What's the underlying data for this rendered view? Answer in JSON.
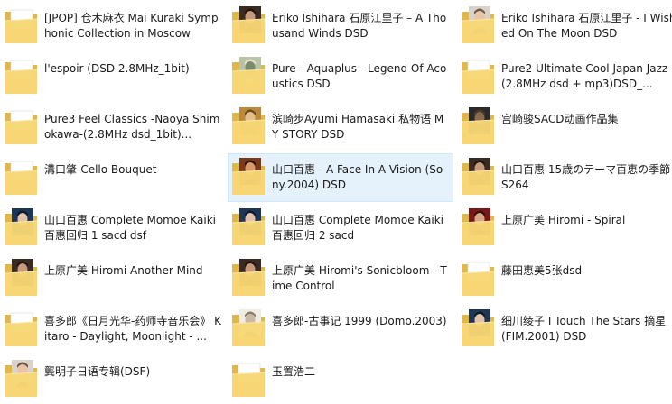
{
  "items": [
    {
      "name": "[JPOP] 仓木麻衣 Mai Kuraki Symphonic Collection in Moscow",
      "thumb": "none"
    },
    {
      "name": "Eriko Ishihara 石原江里子 – A Thousand Winds  DSD",
      "thumb": "portrait"
    },
    {
      "name": "Eriko Ishihara 石原江里子 - I Wished On The Moon DSD",
      "thumb": "portrait-light"
    },
    {
      "name": "l'espoir (DSD 2.8MHz_1bit)",
      "thumb": "none"
    },
    {
      "name": "Pure - Aquaplus - Legend Of Acoustics DSD",
      "thumb": "art"
    },
    {
      "name": "Pure2 Ultimate Cool Japan Jazz(2.8MHz dsd + mp3)DSD_...",
      "thumb": "none"
    },
    {
      "name": "Pure3 Feel Classics -Naoya Shimokawa-(2.8MHz dsd_1bit)...",
      "thumb": "none"
    },
    {
      "name": "滨崎步Ayumi Hamasaki 私物语 MY STORY DSD",
      "thumb": "portrait-gold"
    },
    {
      "name": "宫崎骏SACD动画作品集",
      "thumb": "art-dark"
    },
    {
      "name": "溝口肇-Cello Bouquet",
      "thumb": "none"
    },
    {
      "name": "山口百惠 - A Face In A Vision (Sony.2004) DSD",
      "thumb": "portrait-warm"
    },
    {
      "name": "山口百惠 15歳のテーマ百恵の季節 -S264",
      "thumb": "portrait"
    },
    {
      "name": "山口百惠 Complete Momoe Kaiki 百惠回归  1 sacd  dsf",
      "thumb": "portrait-blue"
    },
    {
      "name": "山口百惠 Complete Momoe Kaiki 百惠回归  2 sacd",
      "thumb": "portrait-blue"
    },
    {
      "name": "上原广美 Hiromi - Spiral",
      "thumb": "portrait-red"
    },
    {
      "name": "上原广美 Hiromi Another Mind",
      "thumb": "portrait"
    },
    {
      "name": "上原广美 Hiromi's Sonicbloom - Time Control",
      "thumb": "portrait"
    },
    {
      "name": "藤田恵美5张dsd",
      "thumb": "none"
    },
    {
      "name": "喜多郎《日月光华-药师寺音乐会》 Kitaro - Daylight, Moonlight - ...",
      "thumb": "none"
    },
    {
      "name": "喜多郎-古事记 1999 (Domo.2003)",
      "thumb": "art-light"
    },
    {
      "name": "细川绫子 I Touch The Stars 摘星 (FIM.2001) DSD",
      "thumb": "portrait-blue"
    },
    {
      "name": "龔明子日语专辑(DSF)",
      "thumb": "portrait-light"
    },
    {
      "name": "玉置浩二",
      "thumb": "none"
    }
  ],
  "selected_index": 10,
  "colors": {
    "selection_bg": "#e5f1fb",
    "selection_border": "#cce8ff",
    "folder_back": "#e0b74a",
    "folder_front": "#f8d775"
  }
}
